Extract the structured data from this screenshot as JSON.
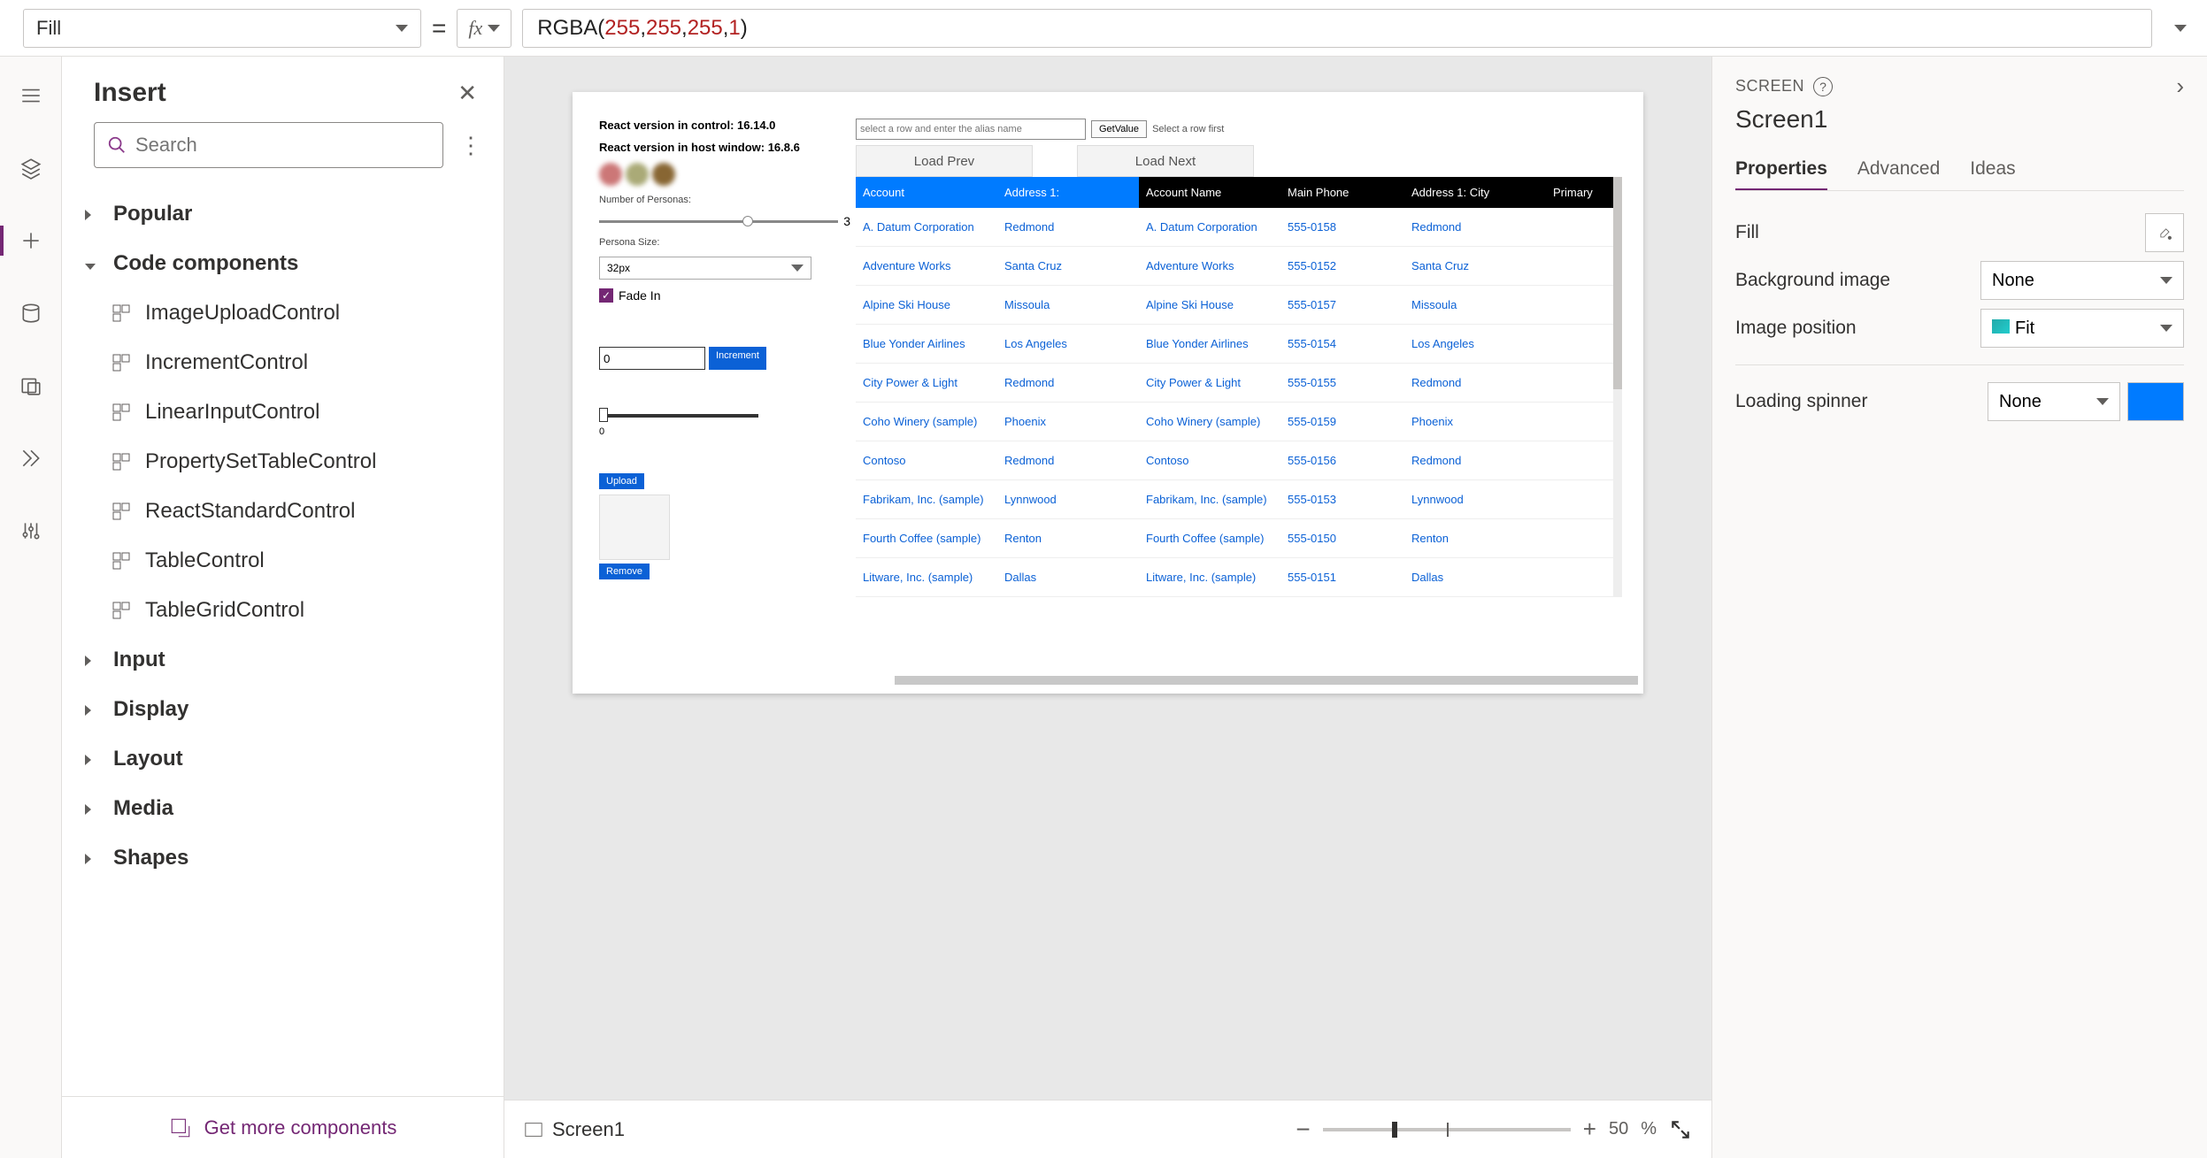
{
  "formula_bar": {
    "property": "Fill",
    "eq": "=",
    "fx": "fx",
    "formula_fn": "RGBA",
    "formula_args": [
      "255",
      "255",
      "255",
      "1"
    ]
  },
  "insert_pane": {
    "title": "Insert",
    "search_placeholder": "Search",
    "categories": {
      "popular": "Popular",
      "code_components": "Code components",
      "input": "Input",
      "display": "Display",
      "layout": "Layout",
      "media": "Media",
      "shapes": "Shapes"
    },
    "components": [
      "ImageUploadControl",
      "IncrementControl",
      "LinearInputControl",
      "PropertySetTableControl",
      "ReactStandardControl",
      "TableControl",
      "TableGridControl"
    ],
    "footer": "Get more components"
  },
  "canvas": {
    "mock": {
      "react_control": "React version in control: 16.14.0",
      "react_host": "React version in host window: 16.8.6",
      "num_personas_label": "Number of Personas:",
      "num_personas_val": "3",
      "persona_size_label": "Persona Size:",
      "persona_size_val": "32px",
      "fade_in": "Fade In",
      "inc_value": "0",
      "inc_btn": "Increment",
      "linear_zero": "0",
      "upload": "Upload",
      "remove": "Remove",
      "alias_placeholder": "select a row and enter the alias name",
      "getvalue": "GetValue",
      "select_hint": "Select a row first",
      "load_prev": "Load Prev",
      "load_next": "Load Next",
      "headers": [
        "Account",
        "Address 1:",
        "Account Name",
        "Main Phone",
        "Address 1: City",
        "Primary"
      ],
      "rows": [
        [
          "A. Datum Corporation",
          "Redmond",
          "A. Datum Corporation",
          "555-0158",
          "Redmond"
        ],
        [
          "Adventure Works",
          "Santa Cruz",
          "Adventure Works",
          "555-0152",
          "Santa Cruz"
        ],
        [
          "Alpine Ski House",
          "Missoula",
          "Alpine Ski House",
          "555-0157",
          "Missoula"
        ],
        [
          "Blue Yonder Airlines",
          "Los Angeles",
          "Blue Yonder Airlines",
          "555-0154",
          "Los Angeles"
        ],
        [
          "City Power & Light",
          "Redmond",
          "City Power & Light",
          "555-0155",
          "Redmond"
        ],
        [
          "Coho Winery (sample)",
          "Phoenix",
          "Coho Winery (sample)",
          "555-0159",
          "Phoenix"
        ],
        [
          "Contoso",
          "Redmond",
          "Contoso",
          "555-0156",
          "Redmond"
        ],
        [
          "Fabrikam, Inc. (sample)",
          "Lynnwood",
          "Fabrikam, Inc. (sample)",
          "555-0153",
          "Lynnwood"
        ],
        [
          "Fourth Coffee (sample)",
          "Renton",
          "Fourth Coffee (sample)",
          "555-0150",
          "Renton"
        ],
        [
          "Litware, Inc. (sample)",
          "Dallas",
          "Litware, Inc. (sample)",
          "555-0151",
          "Dallas"
        ]
      ]
    },
    "footer": {
      "screen": "Screen1",
      "zoom_value": "50",
      "zoom_pct": "%"
    }
  },
  "prop_pane": {
    "kind": "SCREEN",
    "title": "Screen1",
    "tabs": {
      "properties": "Properties",
      "advanced": "Advanced",
      "ideas": "Ideas"
    },
    "props": {
      "fill": "Fill",
      "bg_image": "Background image",
      "bg_image_val": "None",
      "img_pos": "Image position",
      "img_pos_val": "Fit",
      "loading": "Loading spinner",
      "loading_val": "None",
      "loading_color": "#007bff"
    }
  }
}
